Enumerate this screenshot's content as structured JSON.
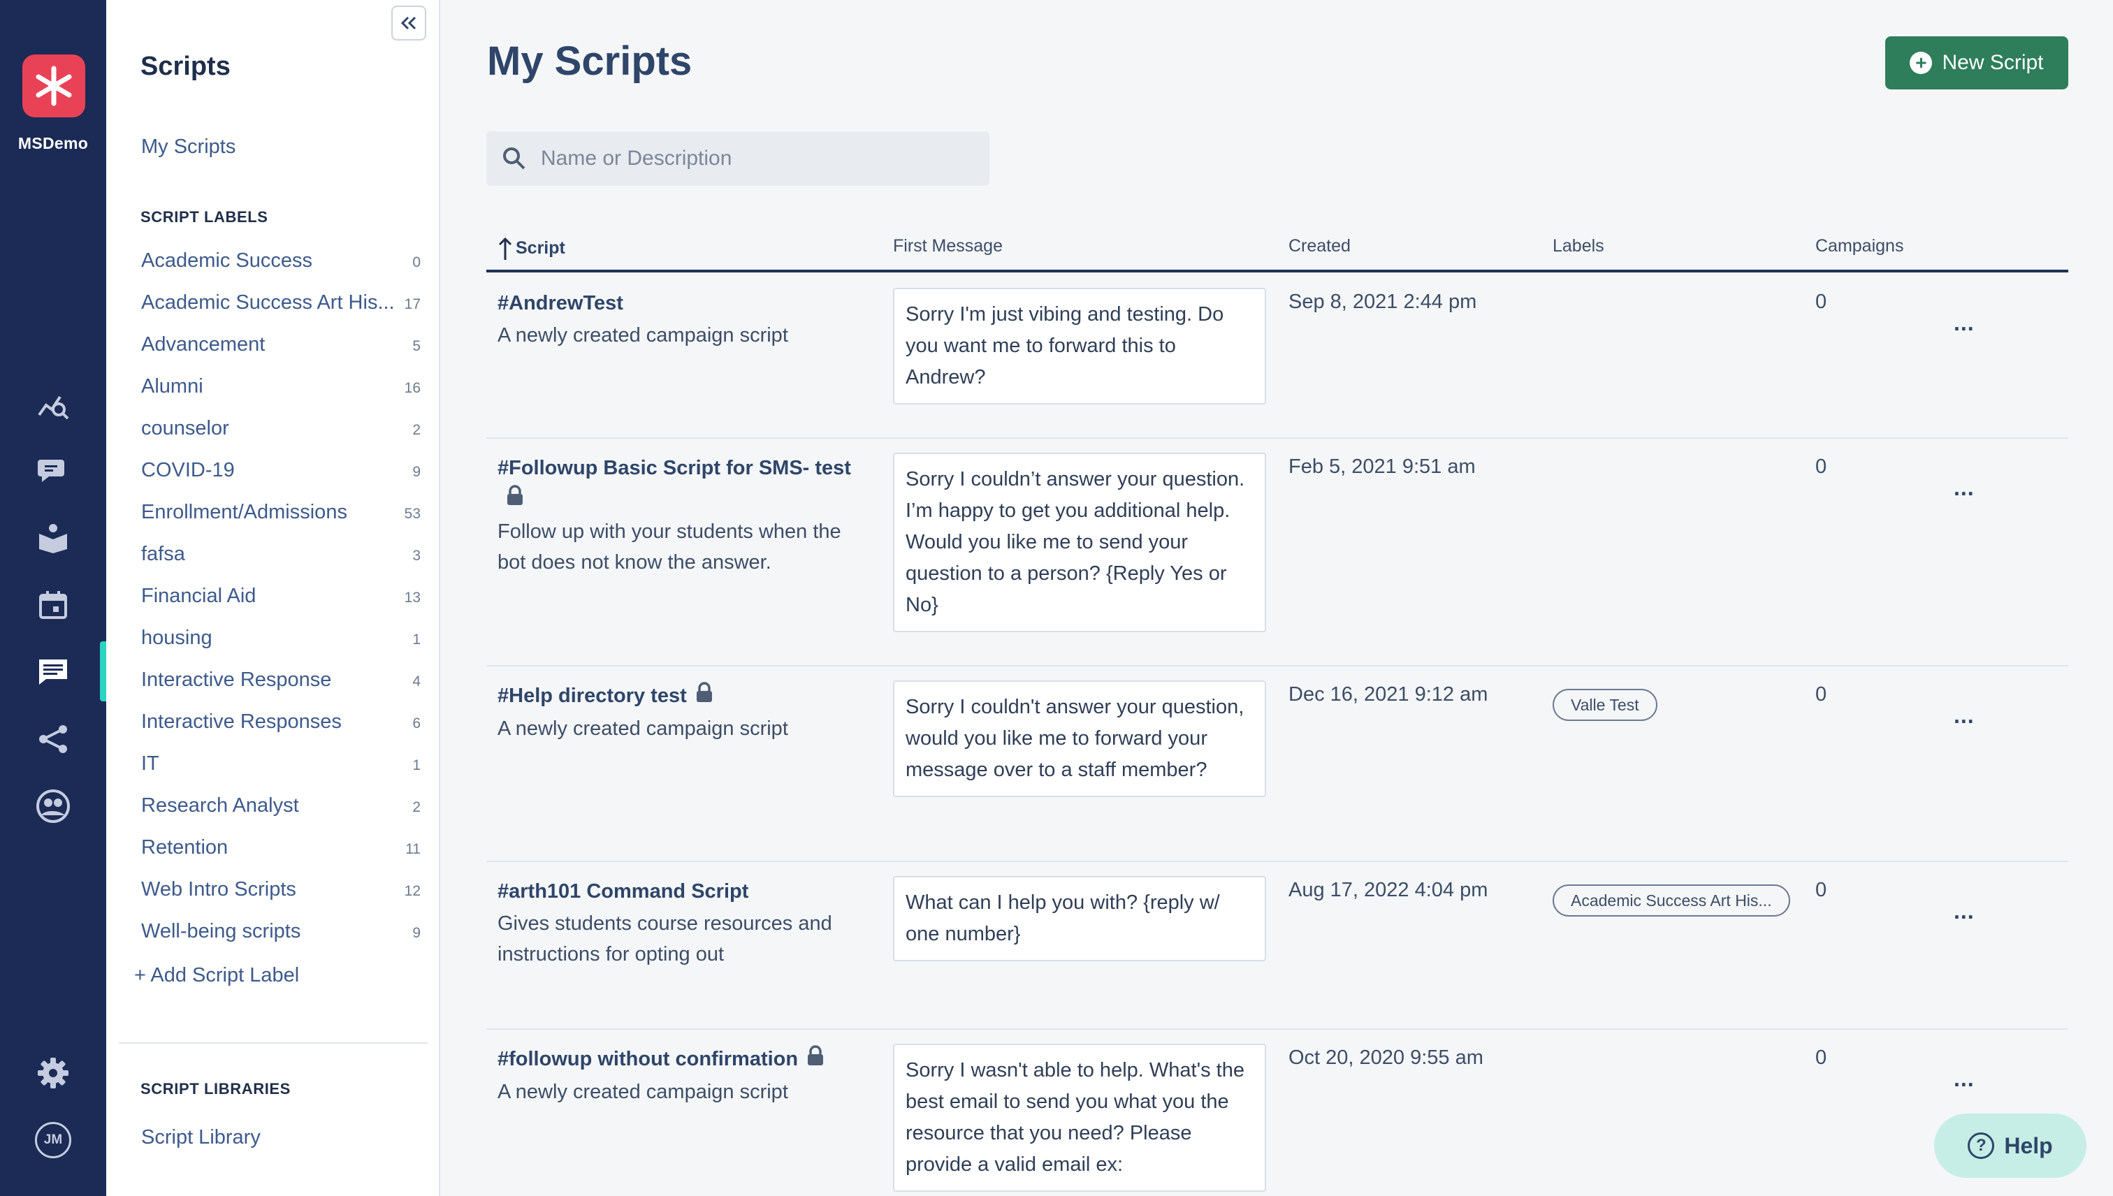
{
  "org": {
    "name": "MSDemo"
  },
  "rail": {
    "icons": [
      "analytics-icon",
      "conversations-icon",
      "knowledge-base-icon",
      "calendar-icon",
      "scripts-icon",
      "integrations-icon",
      "contacts-icon"
    ],
    "bottom_icons": [
      "settings-icon"
    ],
    "avatar_initials": "JM",
    "active": "scripts-icon"
  },
  "sidebar": {
    "title": "Scripts",
    "my_scripts": "My Scripts",
    "labels_heading": "SCRIPT LABELS",
    "labels": [
      {
        "name": "Academic Success",
        "count": "0"
      },
      {
        "name": "Academic Success Art His...",
        "count": "17"
      },
      {
        "name": "Advancement",
        "count": "5"
      },
      {
        "name": "Alumni",
        "count": "16"
      },
      {
        "name": "counselor",
        "count": "2"
      },
      {
        "name": "COVID-19",
        "count": "9"
      },
      {
        "name": "Enrollment/Admissions",
        "count": "53"
      },
      {
        "name": "fafsa",
        "count": "3"
      },
      {
        "name": "Financial Aid",
        "count": "13"
      },
      {
        "name": "housing",
        "count": "1"
      },
      {
        "name": "Interactive Response",
        "count": "4"
      },
      {
        "name": "Interactive Responses",
        "count": "6"
      },
      {
        "name": "IT",
        "count": "1"
      },
      {
        "name": "Research Analyst",
        "count": "2"
      },
      {
        "name": "Retention",
        "count": "11"
      },
      {
        "name": "Web Intro Scripts",
        "count": "12"
      },
      {
        "name": "Well-being scripts",
        "count": "9"
      }
    ],
    "add_label": "+ Add Script Label",
    "libraries_heading": "SCRIPT LIBRARIES",
    "library": "Script Library"
  },
  "main": {
    "title": "My Scripts",
    "new_button": "New Script",
    "search_placeholder": "Name or Description",
    "columns": {
      "script": "Script",
      "first_message": "First Message",
      "created": "Created",
      "labels": "Labels",
      "campaigns": "Campaigns"
    },
    "rows": [
      {
        "name": "#AndrewTest",
        "locked": false,
        "description": "A newly created campaign script",
        "message": "Sorry I'm just vibing and testing. Do you want me to forward this to Andrew?",
        "created": "Sep 8, 2021 2:44 pm",
        "label": "",
        "campaigns": "0",
        "more": "..."
      },
      {
        "name": "#Followup Basic Script for SMS- test",
        "locked": true,
        "description": "Follow up with your students when the bot does not know the answer.",
        "message": "Sorry I couldn’t answer your question. I’m happy to get you additional help. Would you like me to send your question to a person? {Reply Yes or No}",
        "created": "Feb 5, 2021 9:51 am",
        "label": "",
        "campaigns": "0",
        "more": "..."
      },
      {
        "name": "#Help directory test",
        "locked": true,
        "description": "A newly created campaign script",
        "message": "Sorry I couldn't answer your question, would you like me to forward your message over to a staff member?",
        "created": "Dec 16, 2021 9:12 am",
        "label": "Valle Test",
        "campaigns": "0",
        "more": "..."
      },
      {
        "name": "#arth101 Command Script",
        "locked": false,
        "description": "Gives students course resources and instructions for opting out",
        "message": "What can I help you with? {reply w/ one number}",
        "created": "Aug 17, 2022 4:04 pm",
        "label": "Academic Success Art His...",
        "campaigns": "0",
        "more": "..."
      },
      {
        "name": "#followup without confirmation",
        "locked": true,
        "description": "A newly created campaign script",
        "message": "Sorry I wasn't able to help. What's the best email to send you what you the resource that you need? Please provide a valid email ex:",
        "created": "Oct 20, 2020 9:55 am",
        "label": "",
        "campaigns": "0",
        "more": "..."
      }
    ]
  },
  "help": {
    "label": "Help"
  },
  "colors": {
    "rail_bg": "#1b2b56",
    "logo_bg": "#e94257",
    "primary_button": "#2e7d5b",
    "active_accent": "#2bd4c0",
    "help_bg": "#c6eee6"
  }
}
